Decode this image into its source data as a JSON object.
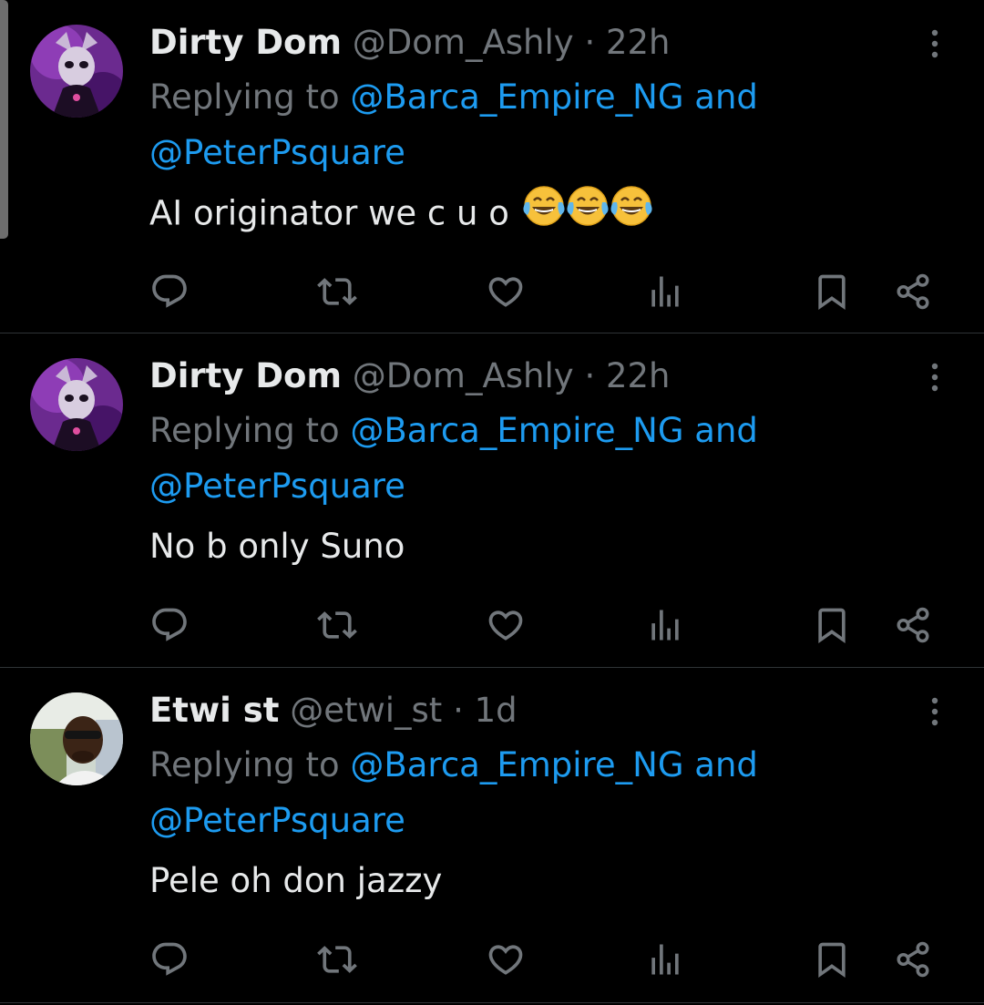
{
  "tweets": [
    {
      "name": "Dirty Dom",
      "handle": "@Dom_Ashly",
      "separator": "·",
      "time": "22h",
      "replying_prefix": "Replying to ",
      "mention_1": "@Barca_Empire_NG",
      "conjunction": " and",
      "mention_2": "@PeterPsquare",
      "text": "AI originator we c u o",
      "emoji": [
        "face-with-tears-of-joy",
        "face-with-tears-of-joy",
        "face-with-tears-of-joy"
      ],
      "avatar": "masked-figure-purple"
    },
    {
      "name": "Dirty Dom",
      "handle": "@Dom_Ashly",
      "separator": "·",
      "time": "22h",
      "replying_prefix": "Replying to ",
      "mention_1": "@Barca_Empire_NG",
      "conjunction": " and",
      "mention_2": "@PeterPsquare",
      "text": "No b only Suno",
      "avatar": "masked-figure-purple"
    },
    {
      "name": "Etwi st",
      "handle": "@etwi_st",
      "separator": "·",
      "time": "1d",
      "replying_prefix": "Replying to ",
      "mention_1": "@Barca_Empire_NG",
      "conjunction": " and",
      "mention_2": "@PeterPsquare",
      "text": "Pele oh don jazzy",
      "avatar": "man-with-sunglasses"
    }
  ],
  "action_icons": [
    "reply-icon",
    "repost-icon",
    "like-icon",
    "views-icon",
    "bookmark-icon",
    "share-icon"
  ],
  "colors": {
    "background": "#000000",
    "primary_text": "#e7e9ea",
    "secondary_text": "#71767b",
    "link": "#1d9bf0",
    "divider": "#2f3336"
  }
}
